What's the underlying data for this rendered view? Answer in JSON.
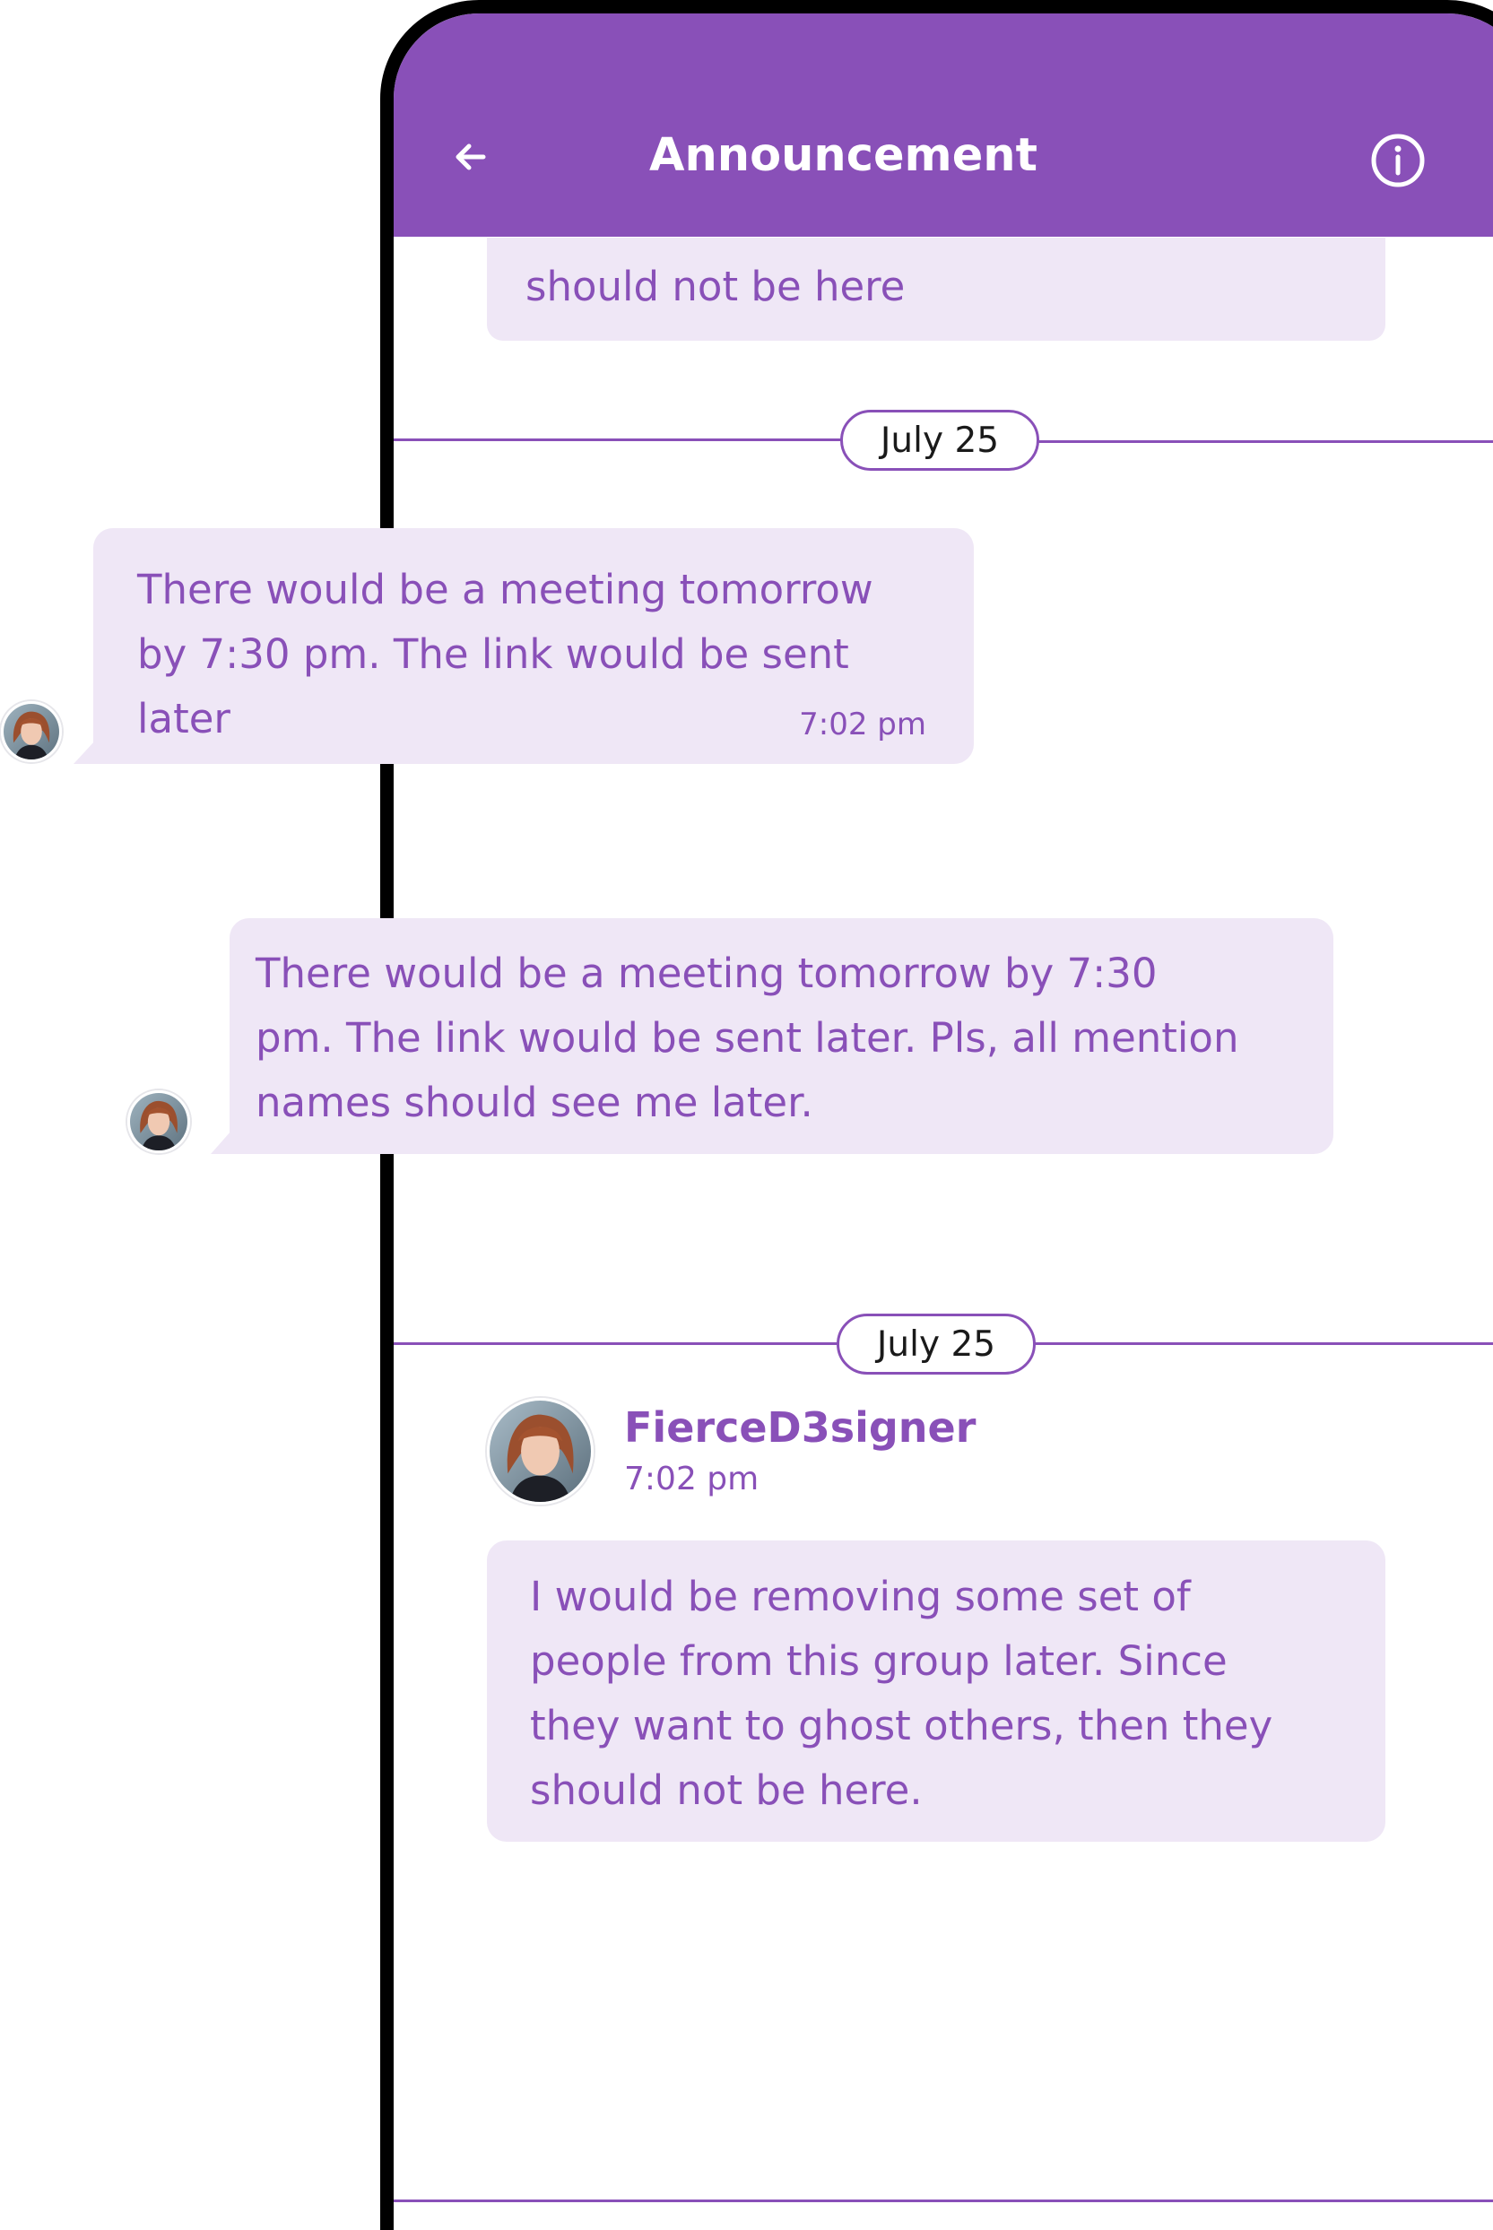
{
  "header": {
    "title": "Announcement",
    "back_icon": "arrow-left-icon",
    "info_icon": "info-circle-icon"
  },
  "messages": {
    "partial_top": {
      "text": "should not be here"
    },
    "date_separator_1": {
      "label": "July 25"
    },
    "msg1": {
      "lines": [
        "There would be a meeting tomorrow",
        "by 7:30 pm. The link would be sent",
        "later"
      ],
      "time": "7:02 pm"
    },
    "msg2": {
      "lines": [
        "There would be a meeting tomorrow by 7:30",
        "pm. The link would be sent later. Pls, all mention",
        "names should see me later."
      ]
    },
    "date_separator_2": {
      "label": "July 25"
    },
    "msg3": {
      "sender": "FierceD3signer",
      "time": "7:02 pm",
      "lines": [
        "I would be removing some set of",
        "people from this group later. Since",
        "they want to ghost others, then they",
        "should not be here."
      ]
    }
  },
  "colors": {
    "accent": "#8950b8",
    "bubble": "#efe7f6",
    "frame": "#000000"
  }
}
